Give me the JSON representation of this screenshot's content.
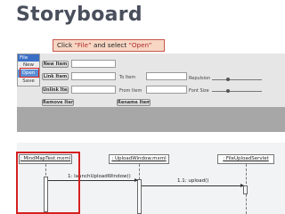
{
  "title": "Storyboard",
  "callout": {
    "pre": "Click ",
    "q1": "“File”",
    "mid": " and select ",
    "q2": "“Open”"
  },
  "menu": {
    "file": "File",
    "items": [
      "New",
      "Open",
      "Save"
    ]
  },
  "buttons": {
    "new_item": "New Item",
    "link_item": "Link Item",
    "unlink_item": "Unlink Item",
    "remove_item": "Remove Item",
    "rename_item": "Rename Item"
  },
  "labels": {
    "to_item": "To Item",
    "from_item": "From Item",
    "repulsion": "Repulsion",
    "font_size": "Font Size"
  },
  "sequence": {
    "lifelines": [
      ": MindMapTest.mxml",
      ": UploadWindow.mxml",
      ": FileUploadServlet"
    ],
    "messages": [
      "1: launchUploadWindow()",
      "1.1: upload()"
    ]
  }
}
